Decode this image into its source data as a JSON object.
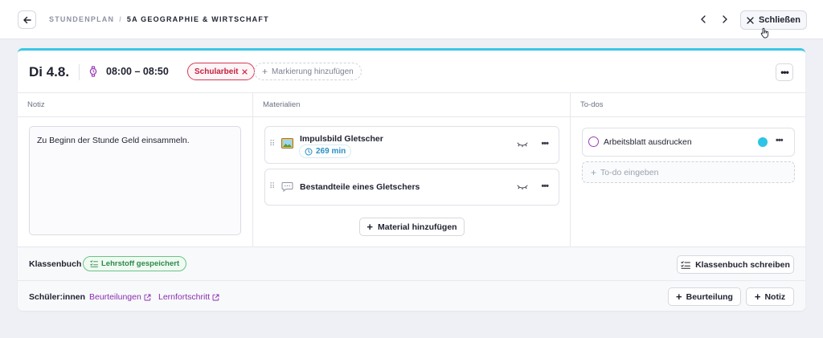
{
  "header": {
    "breadcrumb_root": "STUNDENPLAN",
    "breadcrumb_separator": "/",
    "breadcrumb_current": "5A GEOGRAPHIE & WIRTSCHAFT",
    "close_label": "Schließen"
  },
  "lesson": {
    "day": "Di 4.8.",
    "time": "08:00 – 08:50",
    "tag": "Schularbeit",
    "add_mark": "Markierung hinzufügen"
  },
  "columns": {
    "notiz": "Notiz",
    "materialien": "Materialien",
    "todos": "To-dos"
  },
  "note": {
    "text": "Zu Beginn der Stunde Geld einsammeln."
  },
  "materials": [
    {
      "title": "Impulsbild Gletscher",
      "icon": "image-icon",
      "duration": "269 min"
    },
    {
      "title": "Bestandteile eines Gletschers",
      "icon": "speech-bubble-icon"
    }
  ],
  "add_material": "Material hinzufügen",
  "todos": {
    "items": [
      {
        "label": "Arbeitsblatt ausdrucken",
        "color": "#2ec4e4"
      }
    ],
    "placeholder": "To-do eingeben"
  },
  "klassenbuch": {
    "label": "Klassenbuch",
    "status": "Lehrstoff gespeichert",
    "write_button": "Klassenbuch schreiben"
  },
  "schueler": {
    "label": "Schüler:innen",
    "link_beurteilungen": "Beurteilungen",
    "link_lernfortschritt": "Lernfortschritt",
    "add_beurteilung": "Beurteilung",
    "add_notiz": "Notiz"
  },
  "colors": {
    "accent": "#3ec6e6",
    "tag_red": "#c3213f",
    "success_green": "#2d8a4a",
    "link_purple": "#8a2fae"
  }
}
